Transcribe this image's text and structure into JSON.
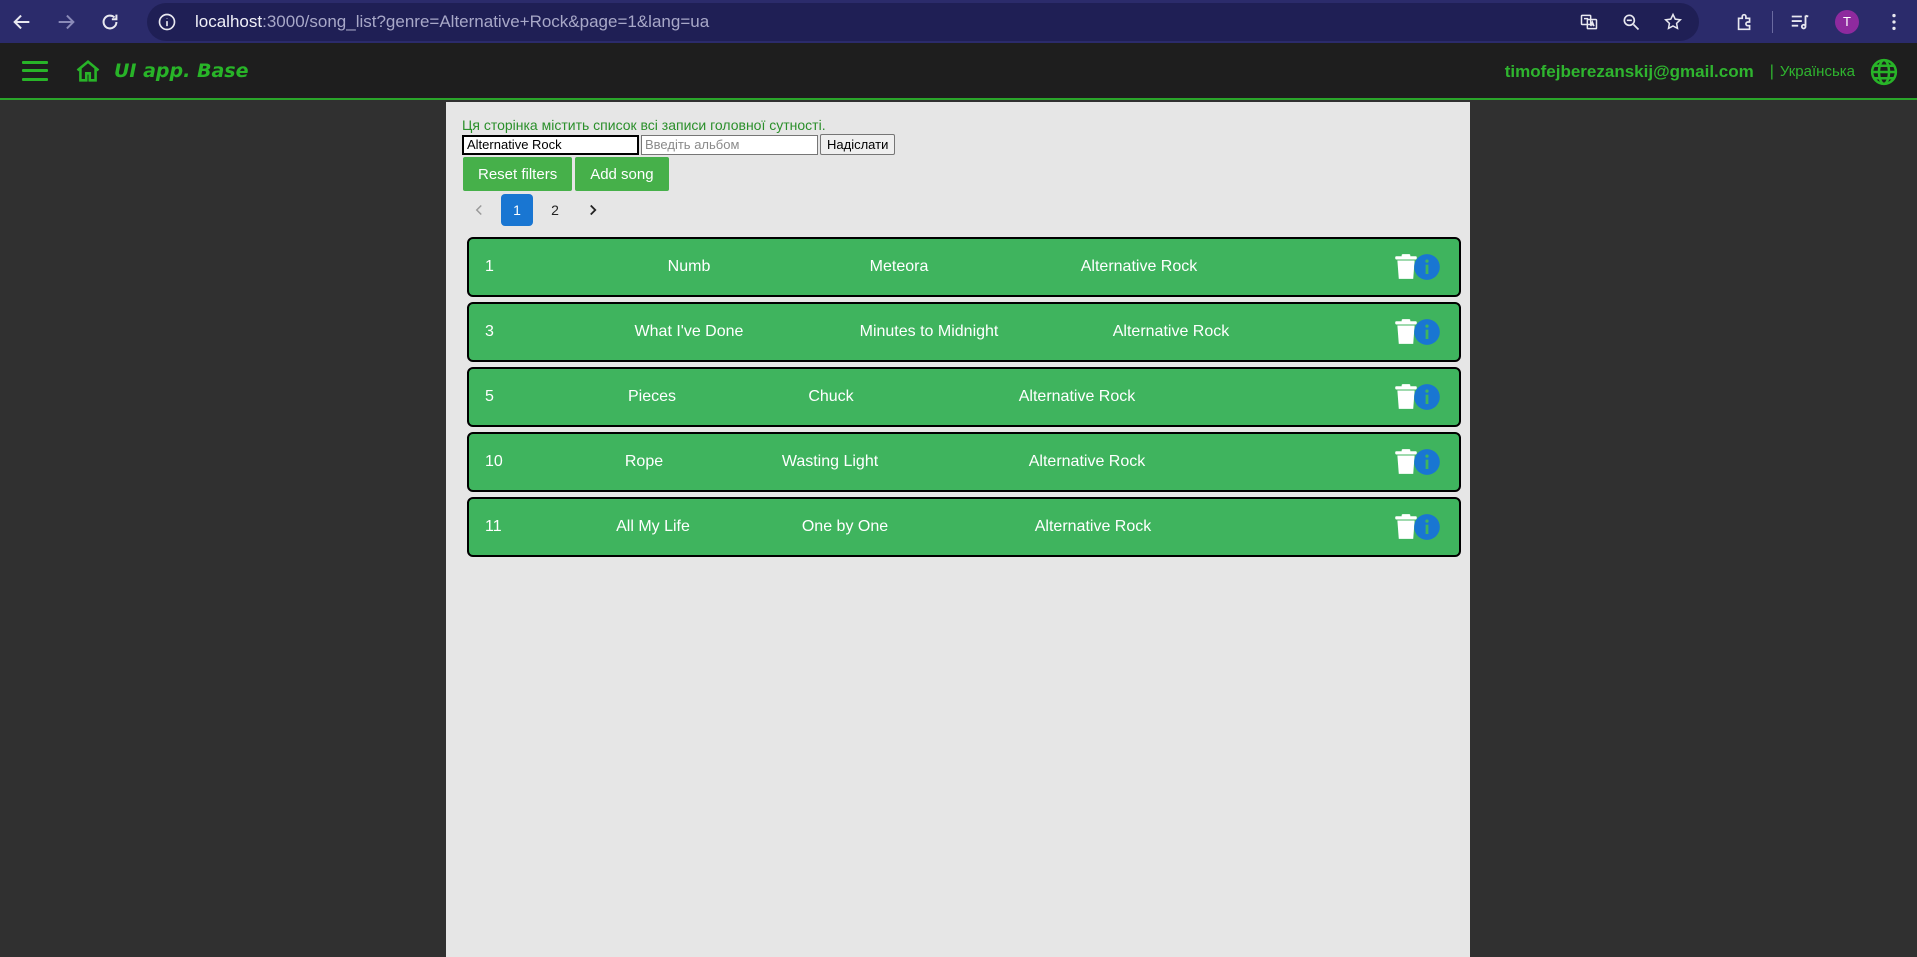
{
  "browser": {
    "url_host": "localhost",
    "url_rest": ":3000/song_list?genre=Alternative+Rock&page=1&lang=ua",
    "avatar_letter": "T"
  },
  "header": {
    "brand": "UI app. Base",
    "email": "timofejberezanskij@gmail.com",
    "lang_separator": "|",
    "language": "Українська"
  },
  "main": {
    "intro": "Ця сторінка містить список всі записи головної сутності.",
    "genre_filter_value": "Alternative Rock",
    "album_placeholder": "Введіть альбом",
    "submit_label": "Надіслати",
    "reset_label": "Reset filters",
    "add_label": "Add song",
    "pages": [
      "1",
      "2"
    ],
    "current_page": "1"
  },
  "songs": [
    {
      "id": "1",
      "title": "Numb",
      "album": "Meteora",
      "genre": "Alternative Rock"
    },
    {
      "id": "3",
      "title": "What I've Done",
      "album": "Minutes to Midnight",
      "genre": "Alternative Rock"
    },
    {
      "id": "5",
      "title": "Pieces",
      "album": "Chuck",
      "genre": "Alternative Rock"
    },
    {
      "id": "10",
      "title": "Rope",
      "album": "Wasting Light",
      "genre": "Alternative Rock"
    },
    {
      "id": "11",
      "title": "All My Life",
      "album": "One by One",
      "genre": "Alternative Rock"
    }
  ],
  "colors": {
    "accent_green": "#28b428",
    "row_green": "#3fb45e",
    "button_green": "#46b04a",
    "info_blue": "#1976d2",
    "chrome_blue": "#2b2b6b"
  }
}
